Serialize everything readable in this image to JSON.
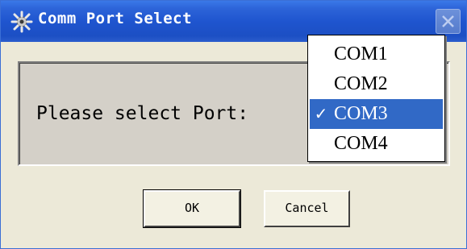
{
  "window": {
    "title": "Comm Port Select",
    "icon": "app-gear-icon",
    "close_icon": "close-icon"
  },
  "dialog": {
    "prompt": "Please select Port:"
  },
  "port_dropdown": {
    "selected": "COM3",
    "check_mark": "✓",
    "options": [
      {
        "label": "COM1",
        "check": ""
      },
      {
        "label": "COM2",
        "check": ""
      },
      {
        "label": "COM3",
        "check": "✓"
      },
      {
        "label": "COM4",
        "check": ""
      }
    ]
  },
  "buttons": {
    "ok_label": "OK",
    "cancel_label": "Cancel"
  },
  "colors": {
    "titlebar": "#1f55cf",
    "selection": "#3169c6",
    "dialog_bg": "#ece9d8"
  }
}
